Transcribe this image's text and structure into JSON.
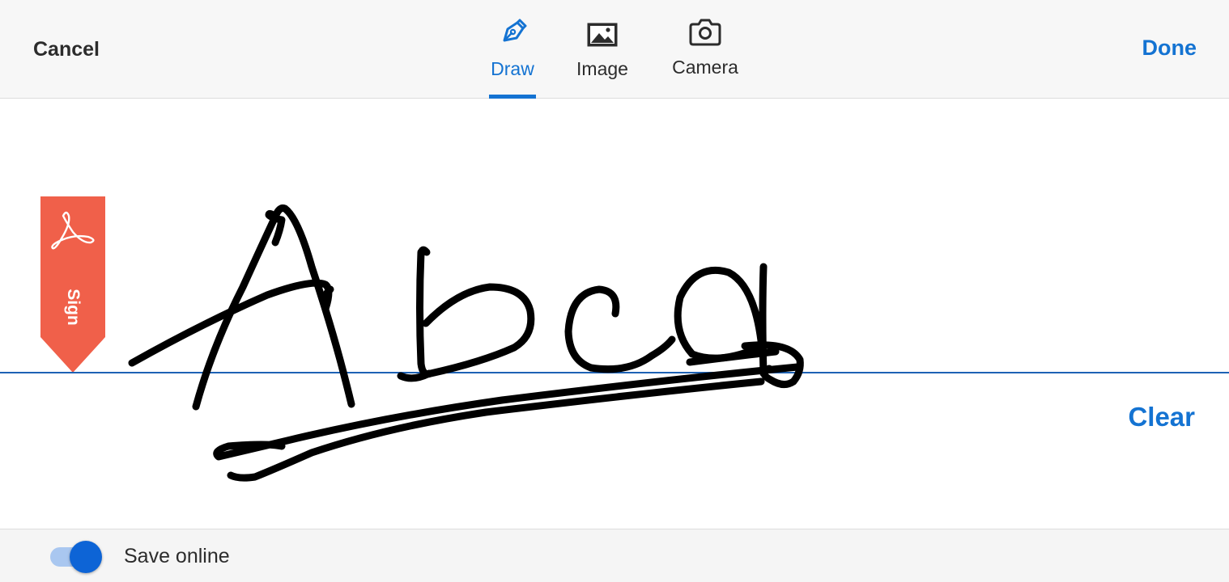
{
  "header": {
    "cancel_label": "Cancel",
    "done_label": "Done",
    "tabs": [
      {
        "label": "Draw",
        "icon": "pen-icon",
        "active": true
      },
      {
        "label": "Image",
        "icon": "image-icon",
        "active": false
      },
      {
        "label": "Camera",
        "icon": "camera-icon",
        "active": false
      }
    ]
  },
  "canvas": {
    "sign_flag_label": "Sign",
    "clear_label": "Clear",
    "signature_text": "Abca"
  },
  "footer": {
    "save_online_label": "Save online",
    "save_online_enabled": true
  },
  "colors": {
    "accent": "#1473d2",
    "sign_flag": "#f0604a",
    "toggle_knob": "#0d64d6",
    "toggle_track": "#a9c7f0"
  }
}
